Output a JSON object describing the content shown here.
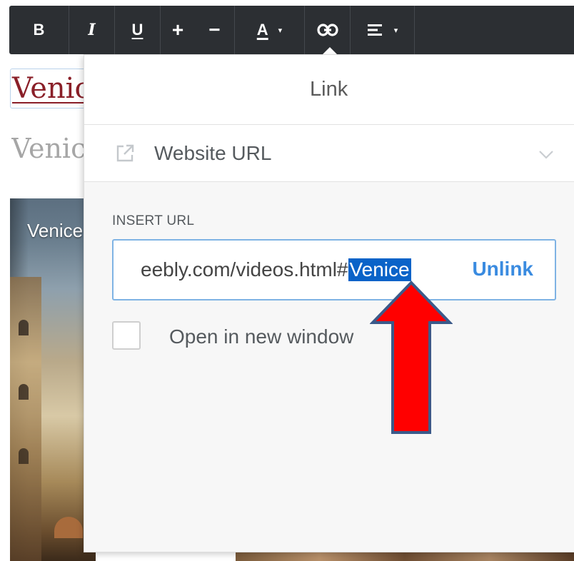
{
  "page": {
    "link_text": "Venice",
    "heading_text": "Venice",
    "image_caption": "Venice"
  },
  "toolbar": {
    "bold": "B",
    "italic": "I",
    "underline": "U",
    "increase_size": "+",
    "decrease_size": "−",
    "text_color": "A",
    "caret": "▾"
  },
  "link_popover": {
    "title": "Link",
    "link_type": "Website URL",
    "field_label": "INSERT URL",
    "url_prefix": "eebly.com/videos.html#",
    "url_selected": "Venice",
    "unlink_label": "Unlink",
    "open_new_window_label": "Open in new window",
    "open_new_window_checked": false
  },
  "colors": {
    "toolbar_bg": "#2c2f33",
    "link_red": "#8a1f28",
    "accent_blue": "#3a8be0",
    "selection_blue": "#0a63c8",
    "arrow_fill": "#ff0000",
    "arrow_stroke": "#3b5a8a"
  }
}
